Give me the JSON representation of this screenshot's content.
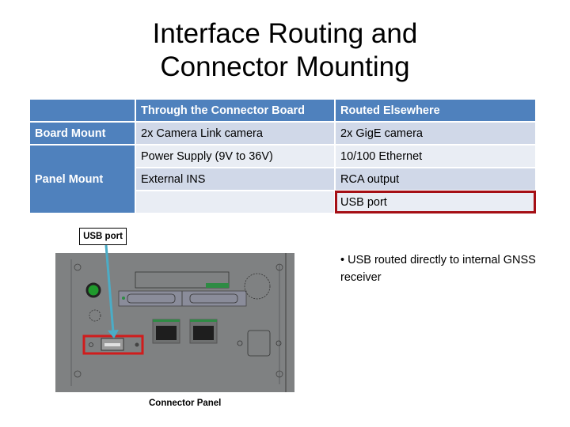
{
  "title": {
    "line1": "Interface Routing and",
    "line2": "Connector Mounting"
  },
  "table": {
    "headers": [
      "",
      "Through the Connector Board",
      "Routed Elsewhere"
    ],
    "row_headers": [
      "Board Mount",
      "Panel Mount"
    ],
    "rows": [
      {
        "through": "2x Camera Link camera",
        "elsewhere": "2x GigE camera"
      },
      {
        "through": "Power Supply (9V to 36V)",
        "elsewhere": "10/100 Ethernet"
      },
      {
        "through": "External INS",
        "elsewhere": "RCA output"
      },
      {
        "through": "",
        "elsewhere": "USB port"
      }
    ],
    "highlighted_cell": "USB port"
  },
  "callout": {
    "label": "USB port"
  },
  "bullet": {
    "text": "• USB routed directly to internal GNSS receiver"
  },
  "figure": {
    "caption": "Connector Panel"
  },
  "colors": {
    "header_blue": "#4f81bd",
    "band_dark": "#d0d8e8",
    "band_light": "#e9edf4",
    "highlight_red": "#a50f15",
    "arrow_cyan": "#4bacc6",
    "panel_gray": "#7f8182",
    "led_green": "#1f9a2c"
  }
}
